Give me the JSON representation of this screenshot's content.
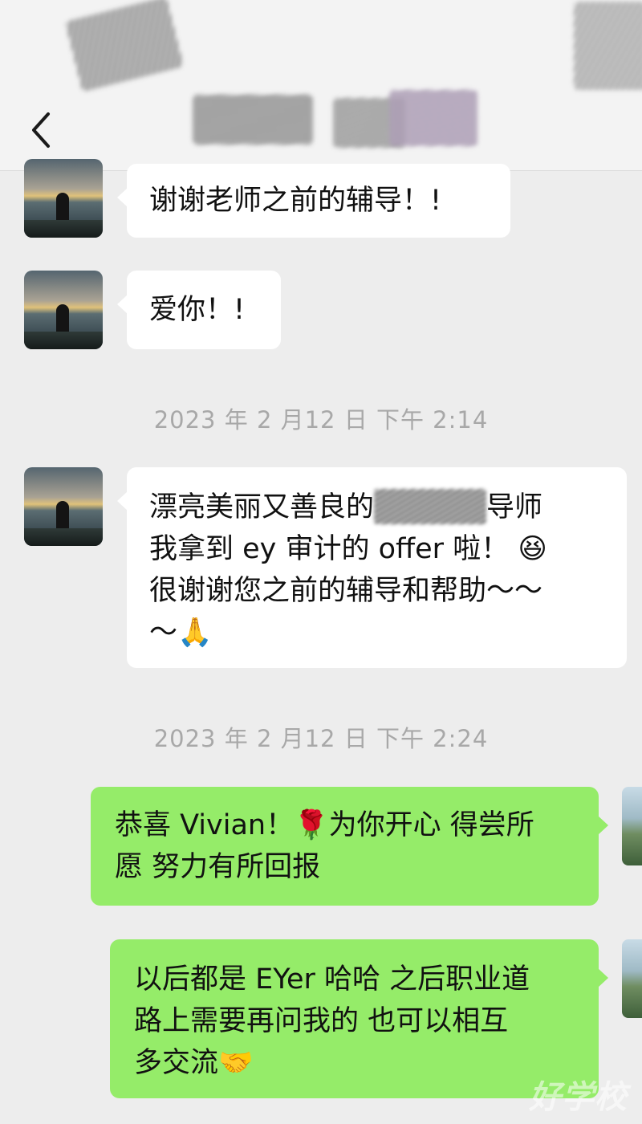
{
  "header": {
    "back_icon": "chevron-left-icon"
  },
  "messages": [
    {
      "side": "in",
      "text": "谢谢老师之前的辅导！!"
    },
    {
      "side": "in",
      "text": "爱你！!"
    },
    {
      "side": "in",
      "text_before_mask": "漂亮美丽又善良的",
      "text_after_mask": "导师\n我拿到 ey 审计的 offer 啦！ 😆\n很谢谢您之前的辅导和帮助～～\n～🙏"
    },
    {
      "side": "out",
      "text": "恭喜 Vivian！🌹为你开心 得尝所\n愿 努力有所回报"
    },
    {
      "side": "out",
      "text": "以后都是 EYer 哈哈 之后职业道\n路上需要再问我的 也可以相互\n多交流🤝"
    }
  ],
  "timestamps": [
    "2023 年 2 月12 日  下午 2:14",
    "2023 年 2 月12 日  下午 2:24"
  ],
  "watermark": "好学校",
  "colors": {
    "background": "#ededed",
    "incoming_bubble": "#ffffff",
    "outgoing_bubble": "#95ec69",
    "timestamp_text": "#a8a8a8"
  }
}
